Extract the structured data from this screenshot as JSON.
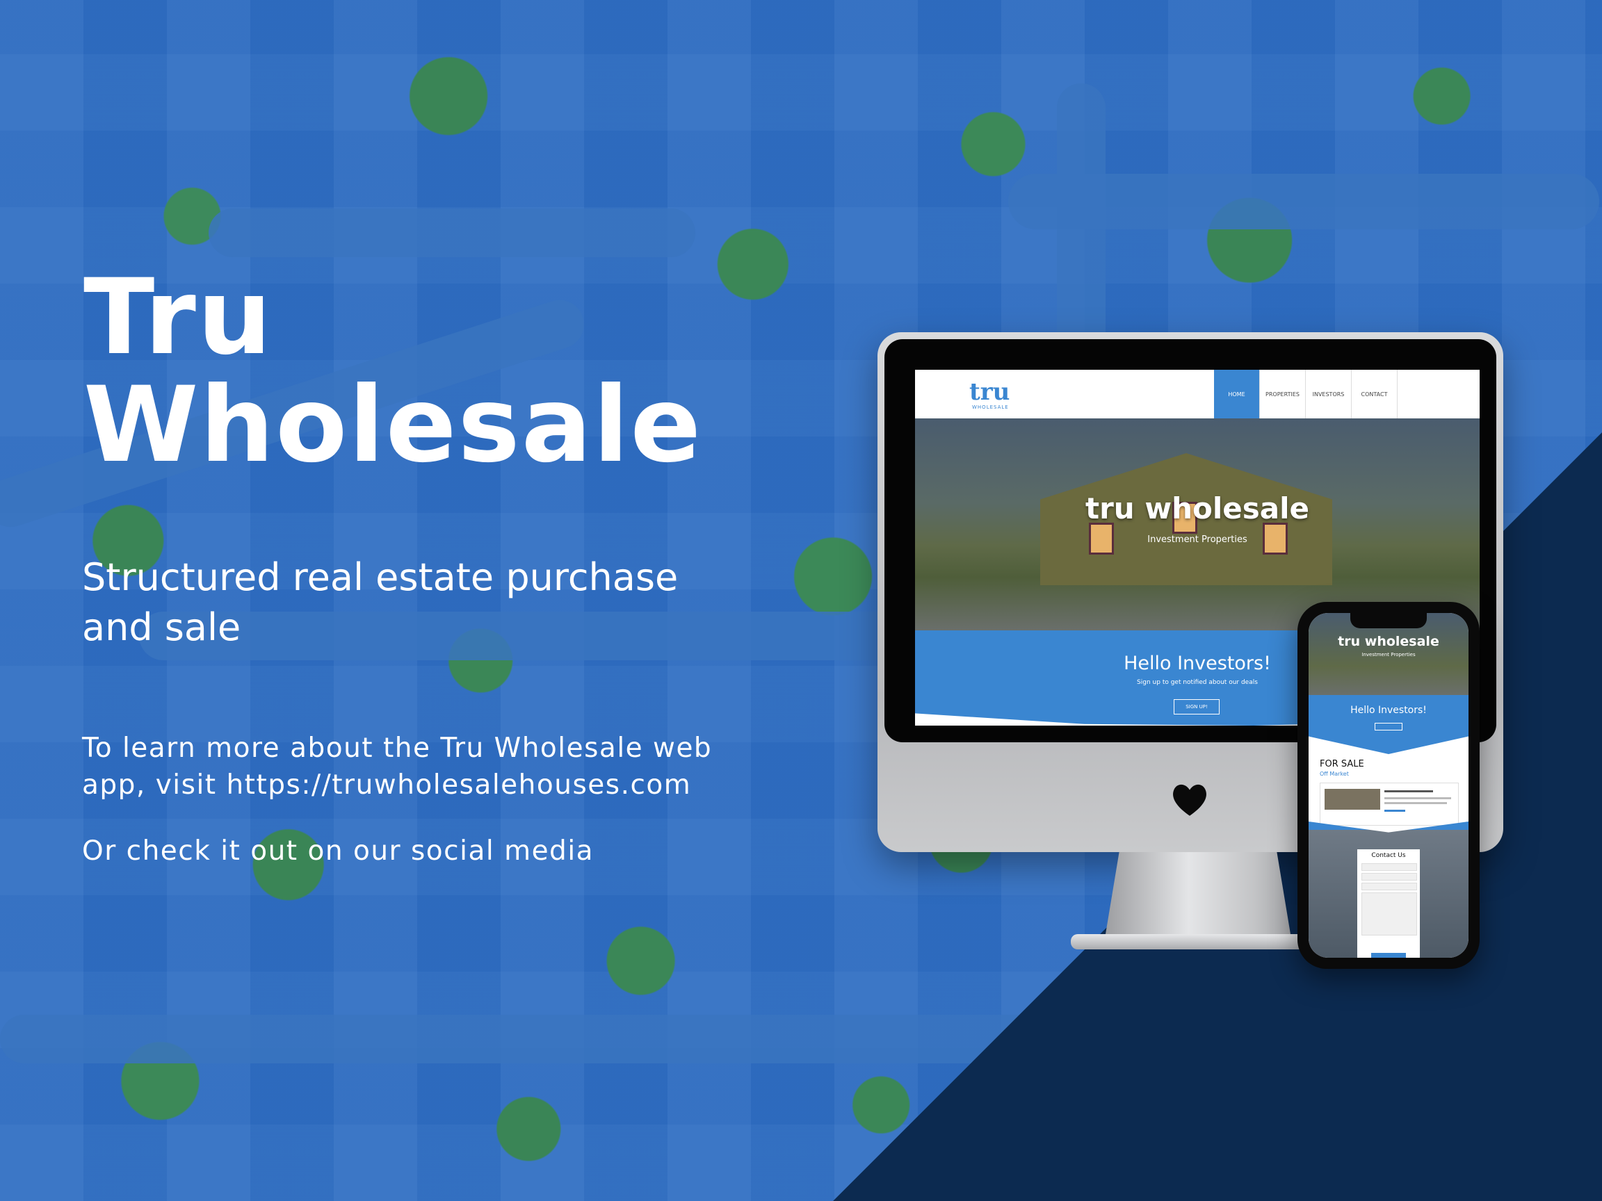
{
  "hero": {
    "title_line1": "Tru",
    "title_line2": "Wholesale",
    "subtitle_line1": "Structured real estate purchase",
    "subtitle_line2": "and sale",
    "info_line1": "To learn more about the Tru Wholesale web",
    "info_line2": "app, visit https://truwholesalehouses.com",
    "social_text": "Or check it out on our social media"
  },
  "colors": {
    "background_blue": "#2f70c4",
    "dark_navy": "#0c2a50",
    "site_accent": "#3a86d1"
  },
  "desktop_site": {
    "logo": "tru",
    "logo_sub": "WHOLESALE",
    "nav": [
      "HOME",
      "PROPERTIES",
      "INVESTORS",
      "CONTACT"
    ],
    "active_nav": "HOME",
    "hero_title": "tru wholesale",
    "hero_subtitle": "Investment Properties",
    "band_title": "Hello Investors!",
    "band_subtitle": "Sign up to get notified about our deals",
    "band_button": "SIGN UP!"
  },
  "mobile_site": {
    "hero_title": "tru wholesale",
    "hero_subtitle": "Investment Properties",
    "band_title": "Hello Investors!",
    "for_sale": "FOR SALE",
    "off_market": "Off Market",
    "contact_title": "Contact Us"
  },
  "monitor_logo_icon": "heart-icon"
}
